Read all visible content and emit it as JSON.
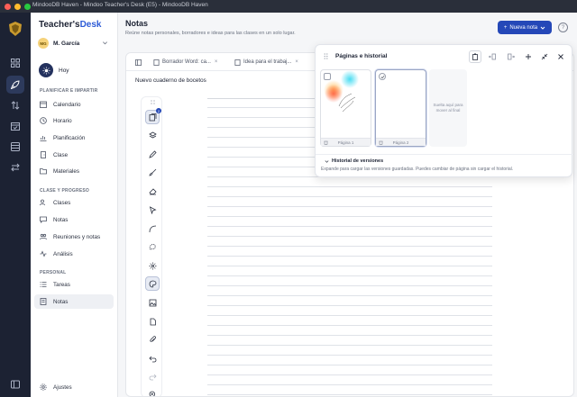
{
  "window": {
    "title": "MindooDB Haven - Mindoo Teacher's Desk (E5) - MindooDB Haven"
  },
  "brand": {
    "part1": "Teacher's",
    "part2": "Desk"
  },
  "user": {
    "initials": "MG",
    "name": "M. García"
  },
  "today": {
    "label": "Hoy"
  },
  "sidebar": {
    "section1": "PLANIFICAR E IMPARTIR",
    "section2": "CLASE Y PROGRESO",
    "section3": "PERSONAL",
    "items": [
      {
        "label": "Calendario",
        "icon": "calendar-icon"
      },
      {
        "label": "Horario",
        "icon": "clock-icon"
      },
      {
        "label": "Planificación",
        "icon": "chart-icon"
      },
      {
        "label": "Clase",
        "icon": "door-icon"
      },
      {
        "label": "Materiales",
        "icon": "folder-icon"
      },
      {
        "label": "Clases",
        "icon": "users-icon"
      },
      {
        "label": "Notas",
        "icon": "chat-icon"
      },
      {
        "label": "Reuniones y notas",
        "icon": "people-icon"
      },
      {
        "label": "Análisis",
        "icon": "pulse-icon"
      },
      {
        "label": "Tareas",
        "icon": "list-icon"
      },
      {
        "label": "Notas",
        "icon": "note-icon"
      }
    ],
    "settings": "Ajustes"
  },
  "header": {
    "title": "Notas",
    "subtitle": "Reúne notas personales, borradores e ideas para las clases en un solo lugar.",
    "new_note": "Nueva nota",
    "help": "?"
  },
  "tabs": [
    {
      "label": "Borrador Word: ca..."
    },
    {
      "label": "Idea para el trabaj..."
    }
  ],
  "notebook": {
    "title": "Nuevo cuaderno de bocetos"
  },
  "toolbar": {
    "badge": "2"
  },
  "panel": {
    "title": "Páginas e historial",
    "pages": [
      {
        "label": "Página 1"
      },
      {
        "label": "Página 2"
      }
    ],
    "dropzone": "Suelta aquí para mover al final",
    "history_title": "Historial de versiones",
    "history_desc": "Expande para cargar las versiones guardadas. Puedes cambiar de página sin cargar el historial."
  }
}
